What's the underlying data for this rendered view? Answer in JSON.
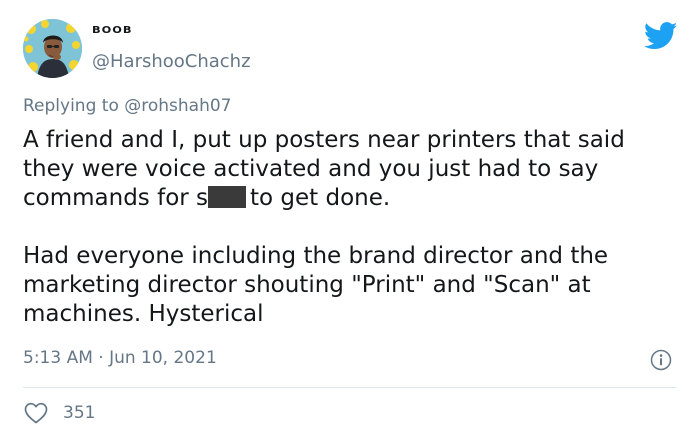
{
  "tweet": {
    "display_name": "ᴮᴼᴼᴮ",
    "handle": "@HarshooChachz",
    "replying_prefix": "Replying to ",
    "replying_handle": "@rohshah07",
    "body": {
      "line_part1": "A friend and I, put up posters near printers that said they were voice activated and you just had to say commands for s",
      "line_part2": "to get done.",
      "paragraph2": "Had everyone including the brand director and the marketing director shouting \"Print\" and \"Scan\" at machines. Hysterical"
    },
    "timestamp": "5:13 AM · Jun 10, 2021",
    "like_count": "351"
  },
  "icons": {
    "logo": "twitter-bird-icon",
    "info": "info-icon",
    "like": "heart-icon"
  },
  "colors": {
    "twitter_blue": "#1da1f2",
    "secondary_text": "#657786",
    "primary_text": "#14171a",
    "divider": "#e1e8ed"
  }
}
